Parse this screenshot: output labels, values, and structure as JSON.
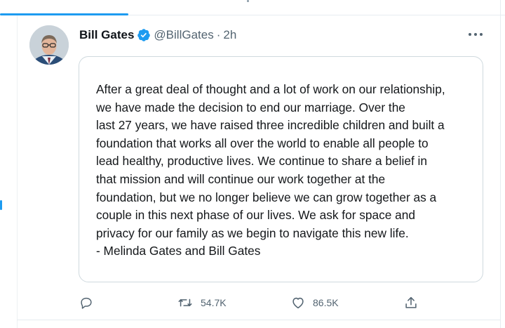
{
  "tweet": {
    "author": {
      "name": "Bill Gates",
      "handle": "@BillGates",
      "separator": "·",
      "time": "2h",
      "verified": true,
      "avatar_icon": "profile-photo"
    },
    "statement_lines": [
      "After a great deal of thought and a lot of work on our relationship,",
      "we have made the decision to end our marriage. Over the",
      "last 27 years, we have raised three incredible children and built a",
      "foundation that works all over the world to enable all people to",
      "lead healthy, productive lives. We continue to share a belief in",
      "that mission and will continue our work together at the",
      "foundation, but we no longer believe we can grow together as a",
      "couple in this next phase of our lives. We ask for space and",
      "privacy for our family as we begin to navigate this new life."
    ],
    "signature": "- Melinda Gates and Bill Gates",
    "actions": {
      "reply": {
        "icon": "reply-icon",
        "count": ""
      },
      "retweet": {
        "icon": "retweet-icon",
        "count": "54.7K"
      },
      "like": {
        "icon": "heart-icon",
        "count": "86.5K"
      },
      "share": {
        "icon": "share-icon"
      }
    }
  },
  "colors": {
    "accent": "#1d9bf0",
    "text": "#0f1419",
    "muted": "#536471",
    "border": "#cfd9de"
  }
}
